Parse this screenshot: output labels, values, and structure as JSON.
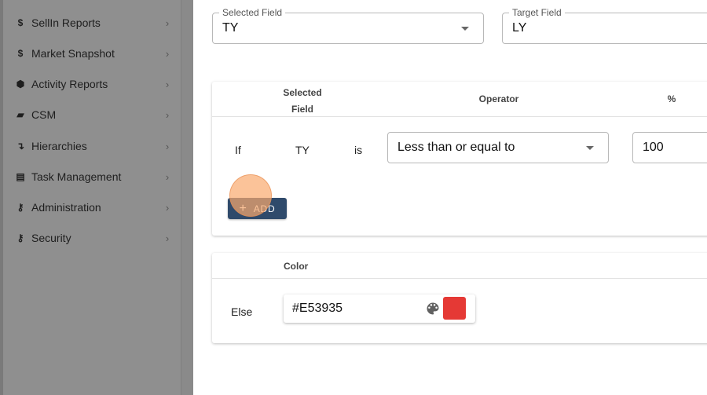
{
  "sidebar": {
    "items": [
      {
        "label": "SellIn Reports",
        "icon": "dollar-icon",
        "glyph": "$"
      },
      {
        "label": "Market Snapshot",
        "icon": "dollar-icon",
        "glyph": "$"
      },
      {
        "label": "Activity Reports",
        "icon": "cube-icon",
        "glyph": "⬢"
      },
      {
        "label": "CSM",
        "icon": "book-icon",
        "glyph": "▰"
      },
      {
        "label": "Hierarchies",
        "icon": "arrow-down-icon",
        "glyph": "↴"
      },
      {
        "label": "Task Management",
        "icon": "task-list-icon",
        "glyph": "▤"
      },
      {
        "label": "Administration",
        "icon": "key-icon",
        "glyph": "⚷"
      },
      {
        "label": "Security",
        "icon": "key-icon",
        "glyph": "⚷"
      }
    ],
    "chevron": "›"
  },
  "fields": {
    "selected_field": {
      "legend": "Selected Field",
      "value": "TY"
    },
    "target_field": {
      "legend": "Target Field",
      "value": "LY"
    }
  },
  "rules_table": {
    "headers": {
      "selected_field_line1": "Selected",
      "selected_field_line2": "Field",
      "operator": "Operator",
      "percent": "%"
    },
    "row": {
      "if": "If",
      "field": "TY",
      "is": "is",
      "operator": "Less than or equal to",
      "value": "100"
    },
    "add_button": {
      "plus": "+",
      "label": "ADD"
    }
  },
  "else_table": {
    "headers": {
      "color": "Color"
    },
    "row": {
      "else": "Else",
      "color_value": "#E53935"
    }
  },
  "colors": {
    "swatch": "#e53935",
    "add_button": "#2f4a6b"
  }
}
